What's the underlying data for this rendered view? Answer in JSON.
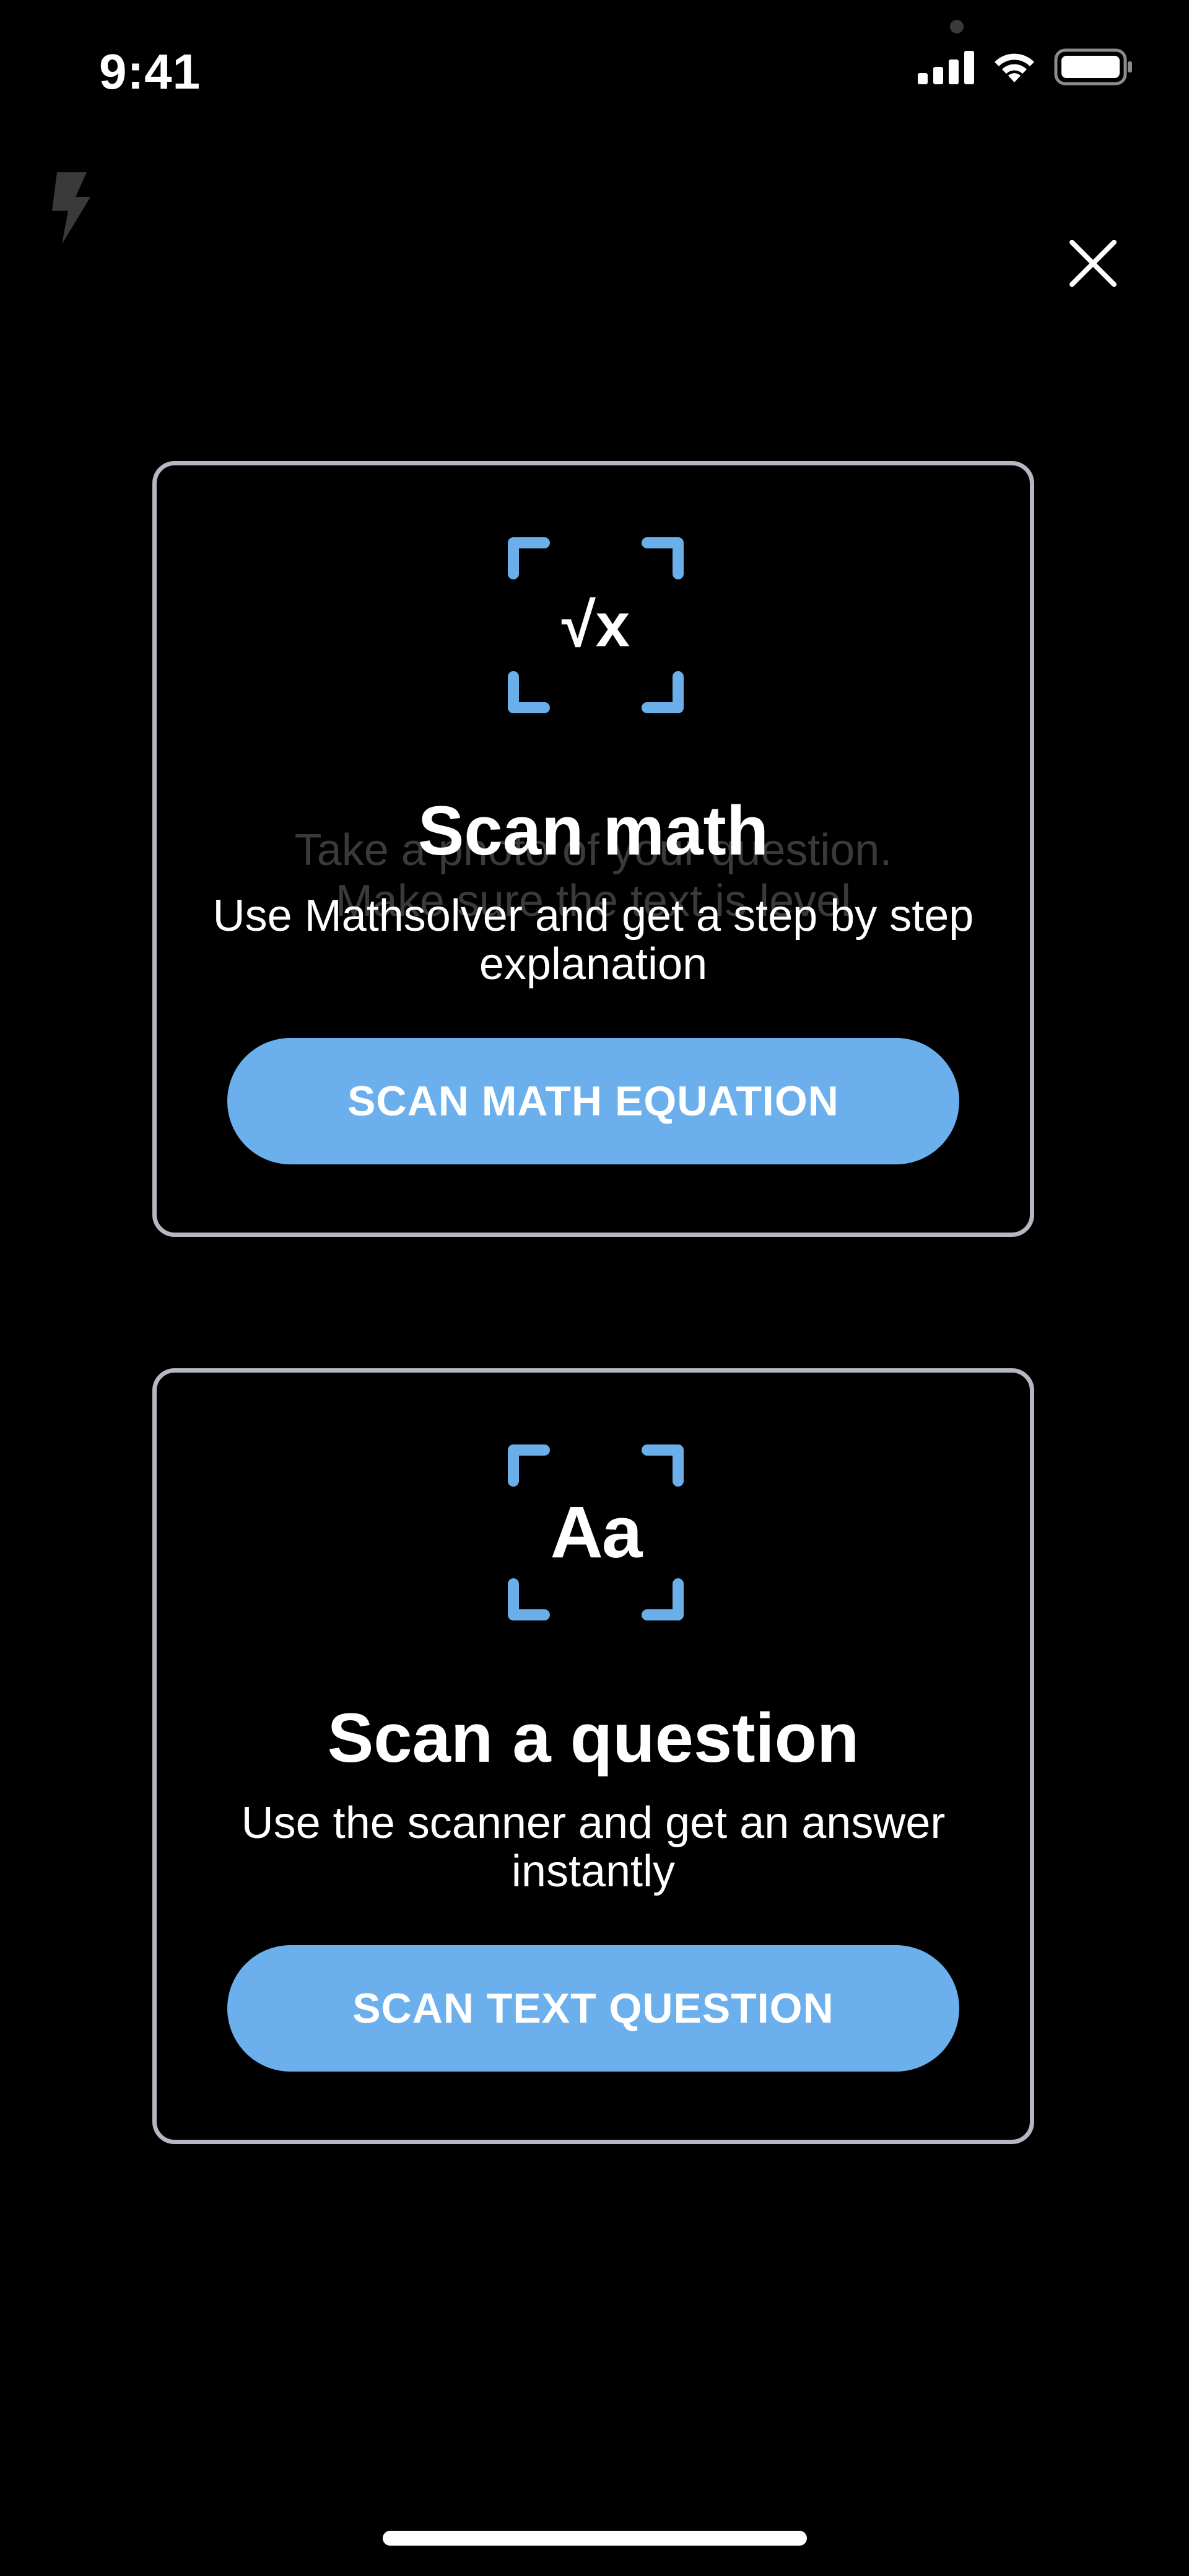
{
  "status_bar": {
    "time": "9:41",
    "icons": [
      "cellular-signal-icon",
      "wifi-icon",
      "battery-icon"
    ]
  },
  "toolbar": {
    "flash_icon": "flash-icon",
    "close_icon": "close-icon"
  },
  "cards": [
    {
      "icon": "square-root-x-icon",
      "icon_symbol": "√x",
      "title": "Scan math",
      "background_hint": "Take a photo of your question.\nMake sure the text is level",
      "description": "Use Mathsolver and get a step by step explanation",
      "button_label": "SCAN MATH EQUATION"
    },
    {
      "icon": "text-aa-icon",
      "icon_symbol": "Aa",
      "title": "Scan a question",
      "description": "Use the scanner and get an answer instantly",
      "button_label": "SCAN TEXT QUESTION"
    }
  ],
  "colors": {
    "background": "#000000",
    "accent": "#6bb0ec",
    "card_border": "#b4b8c3",
    "frame_corners": "#6aaeea"
  }
}
